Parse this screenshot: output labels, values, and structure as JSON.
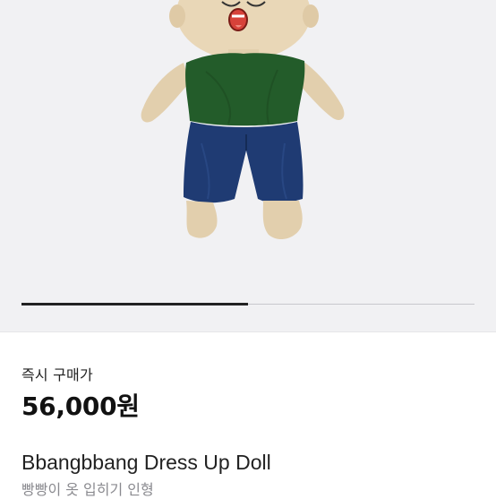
{
  "product": {
    "image_alt": "doll",
    "image_slide_progress": 0.5,
    "buy_now_label": "즉시 구매가",
    "price": "56,000원",
    "title": "Bbangbbang Dress Up Doll",
    "subtitle": "빵빵이 옷 입히기 인형"
  },
  "colors": {
    "hero_bg": "#f1f1f3",
    "shirt": "#235c2a",
    "shorts": "#1f3b73",
    "skin": "#e7d4b2",
    "text_primary": "#111111",
    "text_secondary": "#8a8a8f"
  },
  "icons": []
}
